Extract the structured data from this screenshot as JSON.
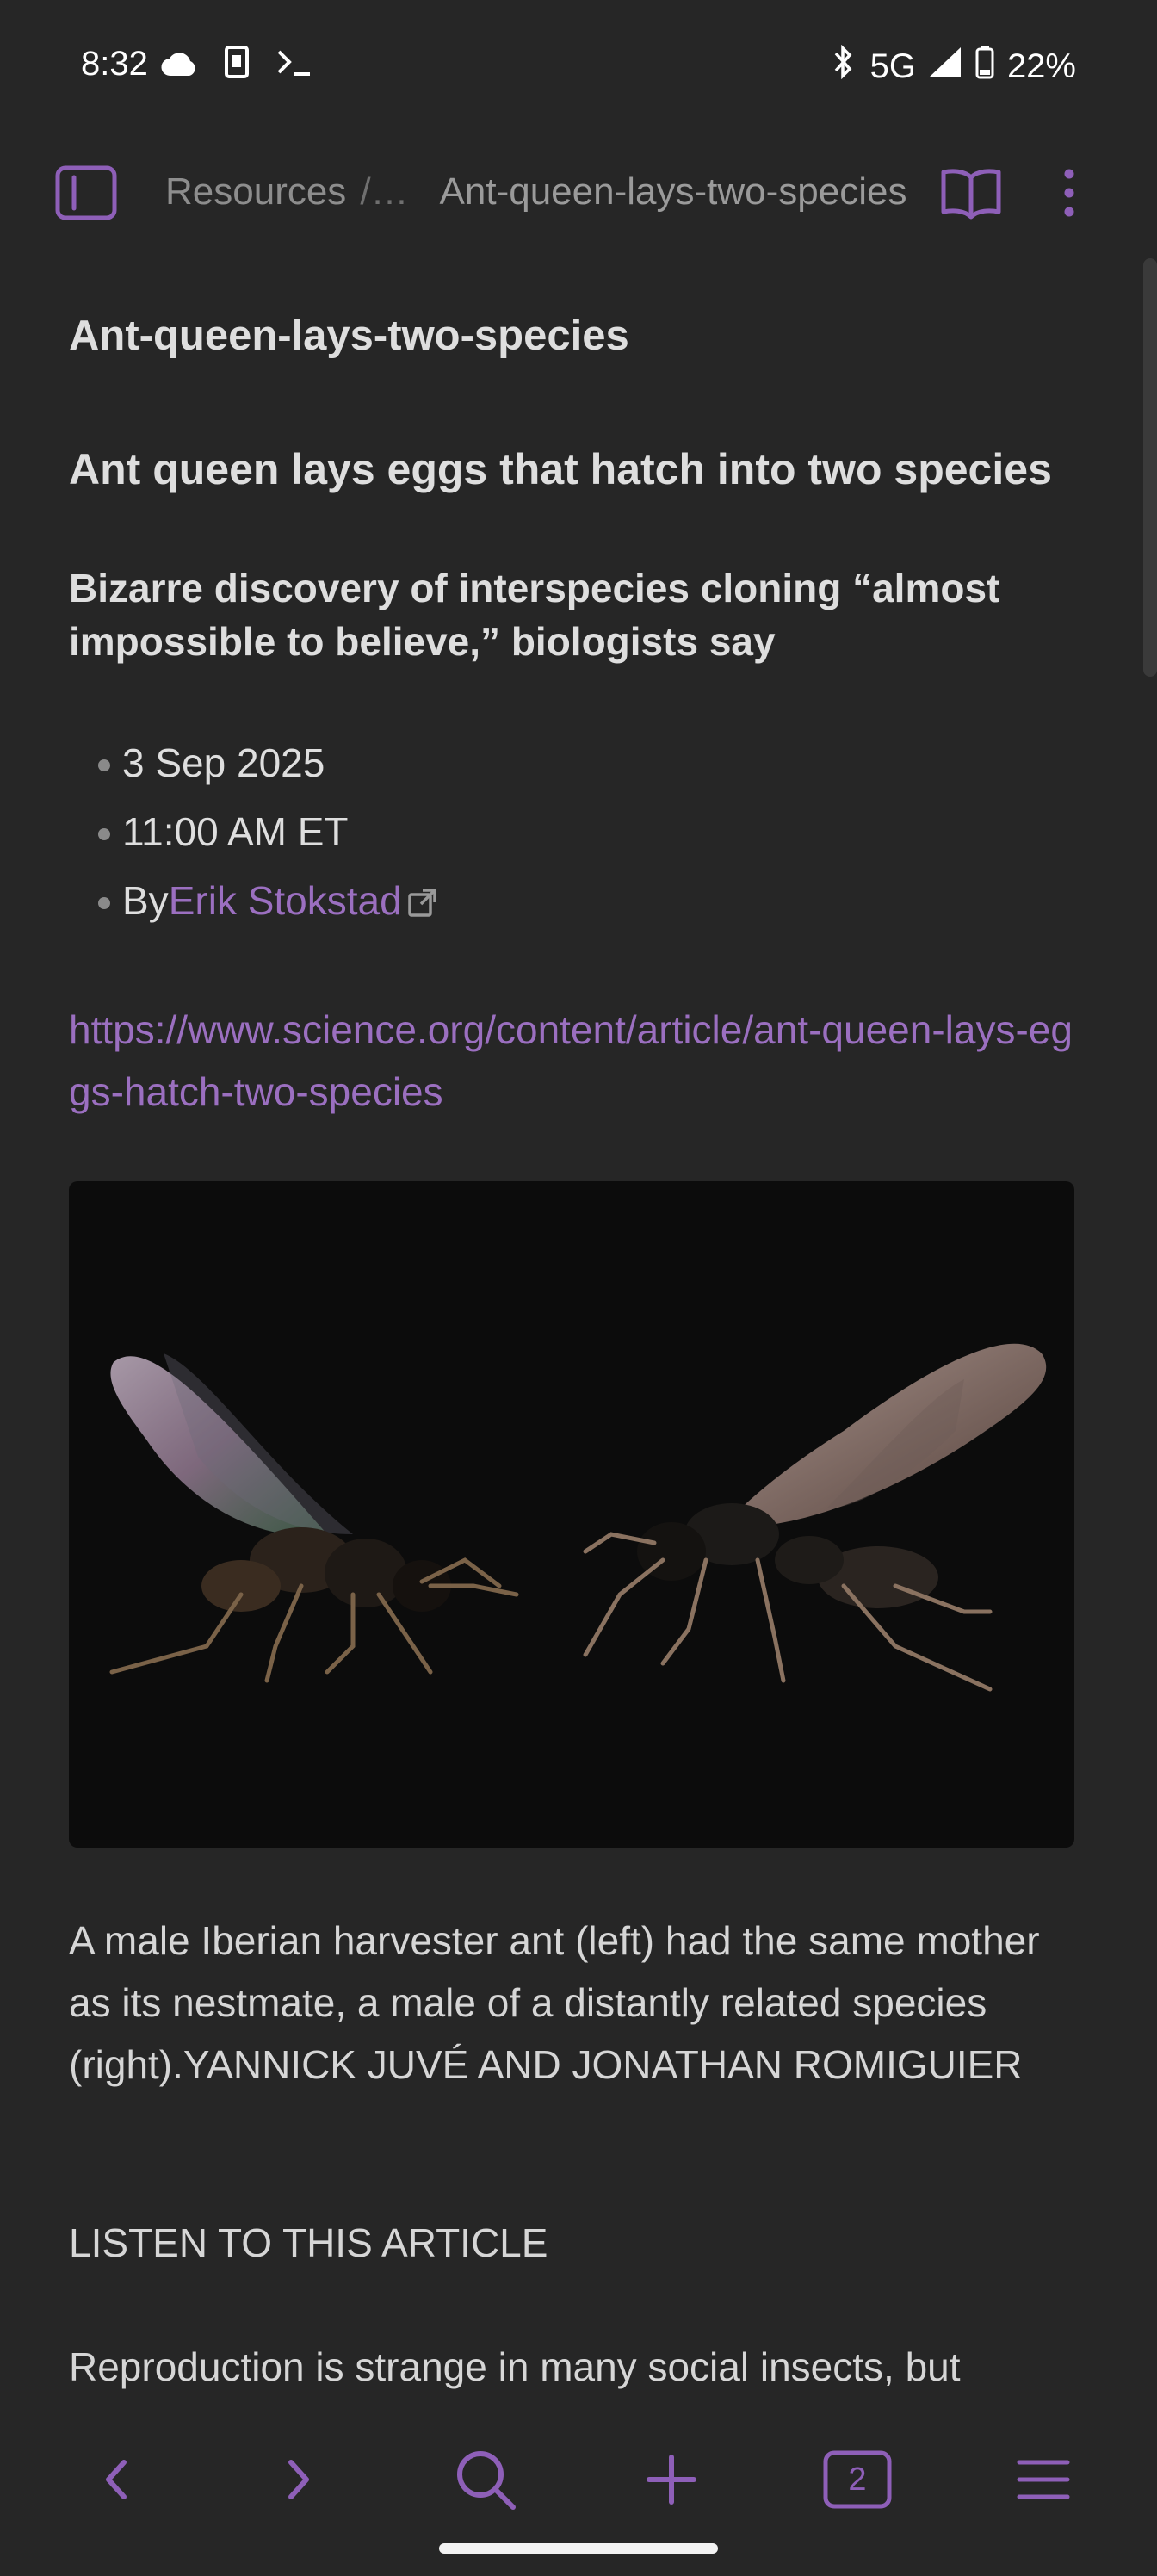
{
  "status_bar": {
    "time": "8:32",
    "network": "5G",
    "battery": "22%"
  },
  "toolbar": {
    "breadcrumb_parent": "Resources",
    "breadcrumb_separator": "/…",
    "breadcrumb_current": "Ant-queen-lays-two-species"
  },
  "note": {
    "title": "Ant-queen-lays-two-species",
    "heading": "Ant queen lays eggs that hatch into two species",
    "subheading": "Bizarre discovery of interspecies cloning “almost impossible to believe,” biologists say",
    "meta": {
      "date": "3 Sep 2025",
      "time": "11:00 AM ET",
      "by_prefix": "By",
      "author": "Erik Stokstad"
    },
    "url": "https://www.science.org/content/article/ant-queen-lays-eggs-hatch-two-species",
    "caption": "A male Iberian harvester ant (left) had the same mother as its nestmate, a male of a distantly related species (right).YANNICK JUVÉ AND JONATHAN ROMIGUIER",
    "listen_label": "LISTEN TO THIS ARTICLE",
    "paragraph_start": "Reproduction is strange in many social insects, but"
  },
  "bottom_nav": {
    "tab_count": "2"
  },
  "colors": {
    "background": "#262626",
    "accent": "#8e5fb8",
    "link": "#9b6fc0",
    "text": "#dedede"
  }
}
